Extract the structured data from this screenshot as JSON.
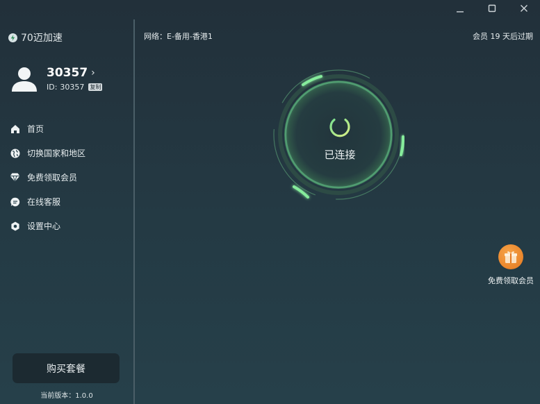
{
  "window": {
    "controls": [
      "minimize-icon",
      "maximize-icon",
      "close-icon"
    ]
  },
  "brand": {
    "name": "70迈加速",
    "icon": "bolt-icon"
  },
  "profile": {
    "name": "30357",
    "id_label": "ID:",
    "id": "30357",
    "copy_label": "复制"
  },
  "nav": {
    "items": [
      {
        "label": "首页",
        "icon": "home-icon"
      },
      {
        "label": "切换国家和地区",
        "icon": "globe-icon"
      },
      {
        "label": "免费领取会员",
        "icon": "diamond-icon"
      },
      {
        "label": "在线客服",
        "icon": "chat-icon"
      },
      {
        "label": "设置中心",
        "icon": "settings-icon"
      }
    ]
  },
  "buy_button": "购买套餐",
  "version": "当前版本：1.0.0",
  "header": {
    "network": "网络：E-备用-香港1",
    "member_status": "会员 19 天后过期"
  },
  "connection": {
    "status": "已连接"
  },
  "gift": {
    "label": "免费领取会员",
    "icon": "gift-icon"
  },
  "colors": {
    "accent_green": "#7fe39a",
    "power_gradient_start": "#7be08f",
    "power_gradient_end": "#d7ef86",
    "gift_orange": "#ee8a2c"
  }
}
